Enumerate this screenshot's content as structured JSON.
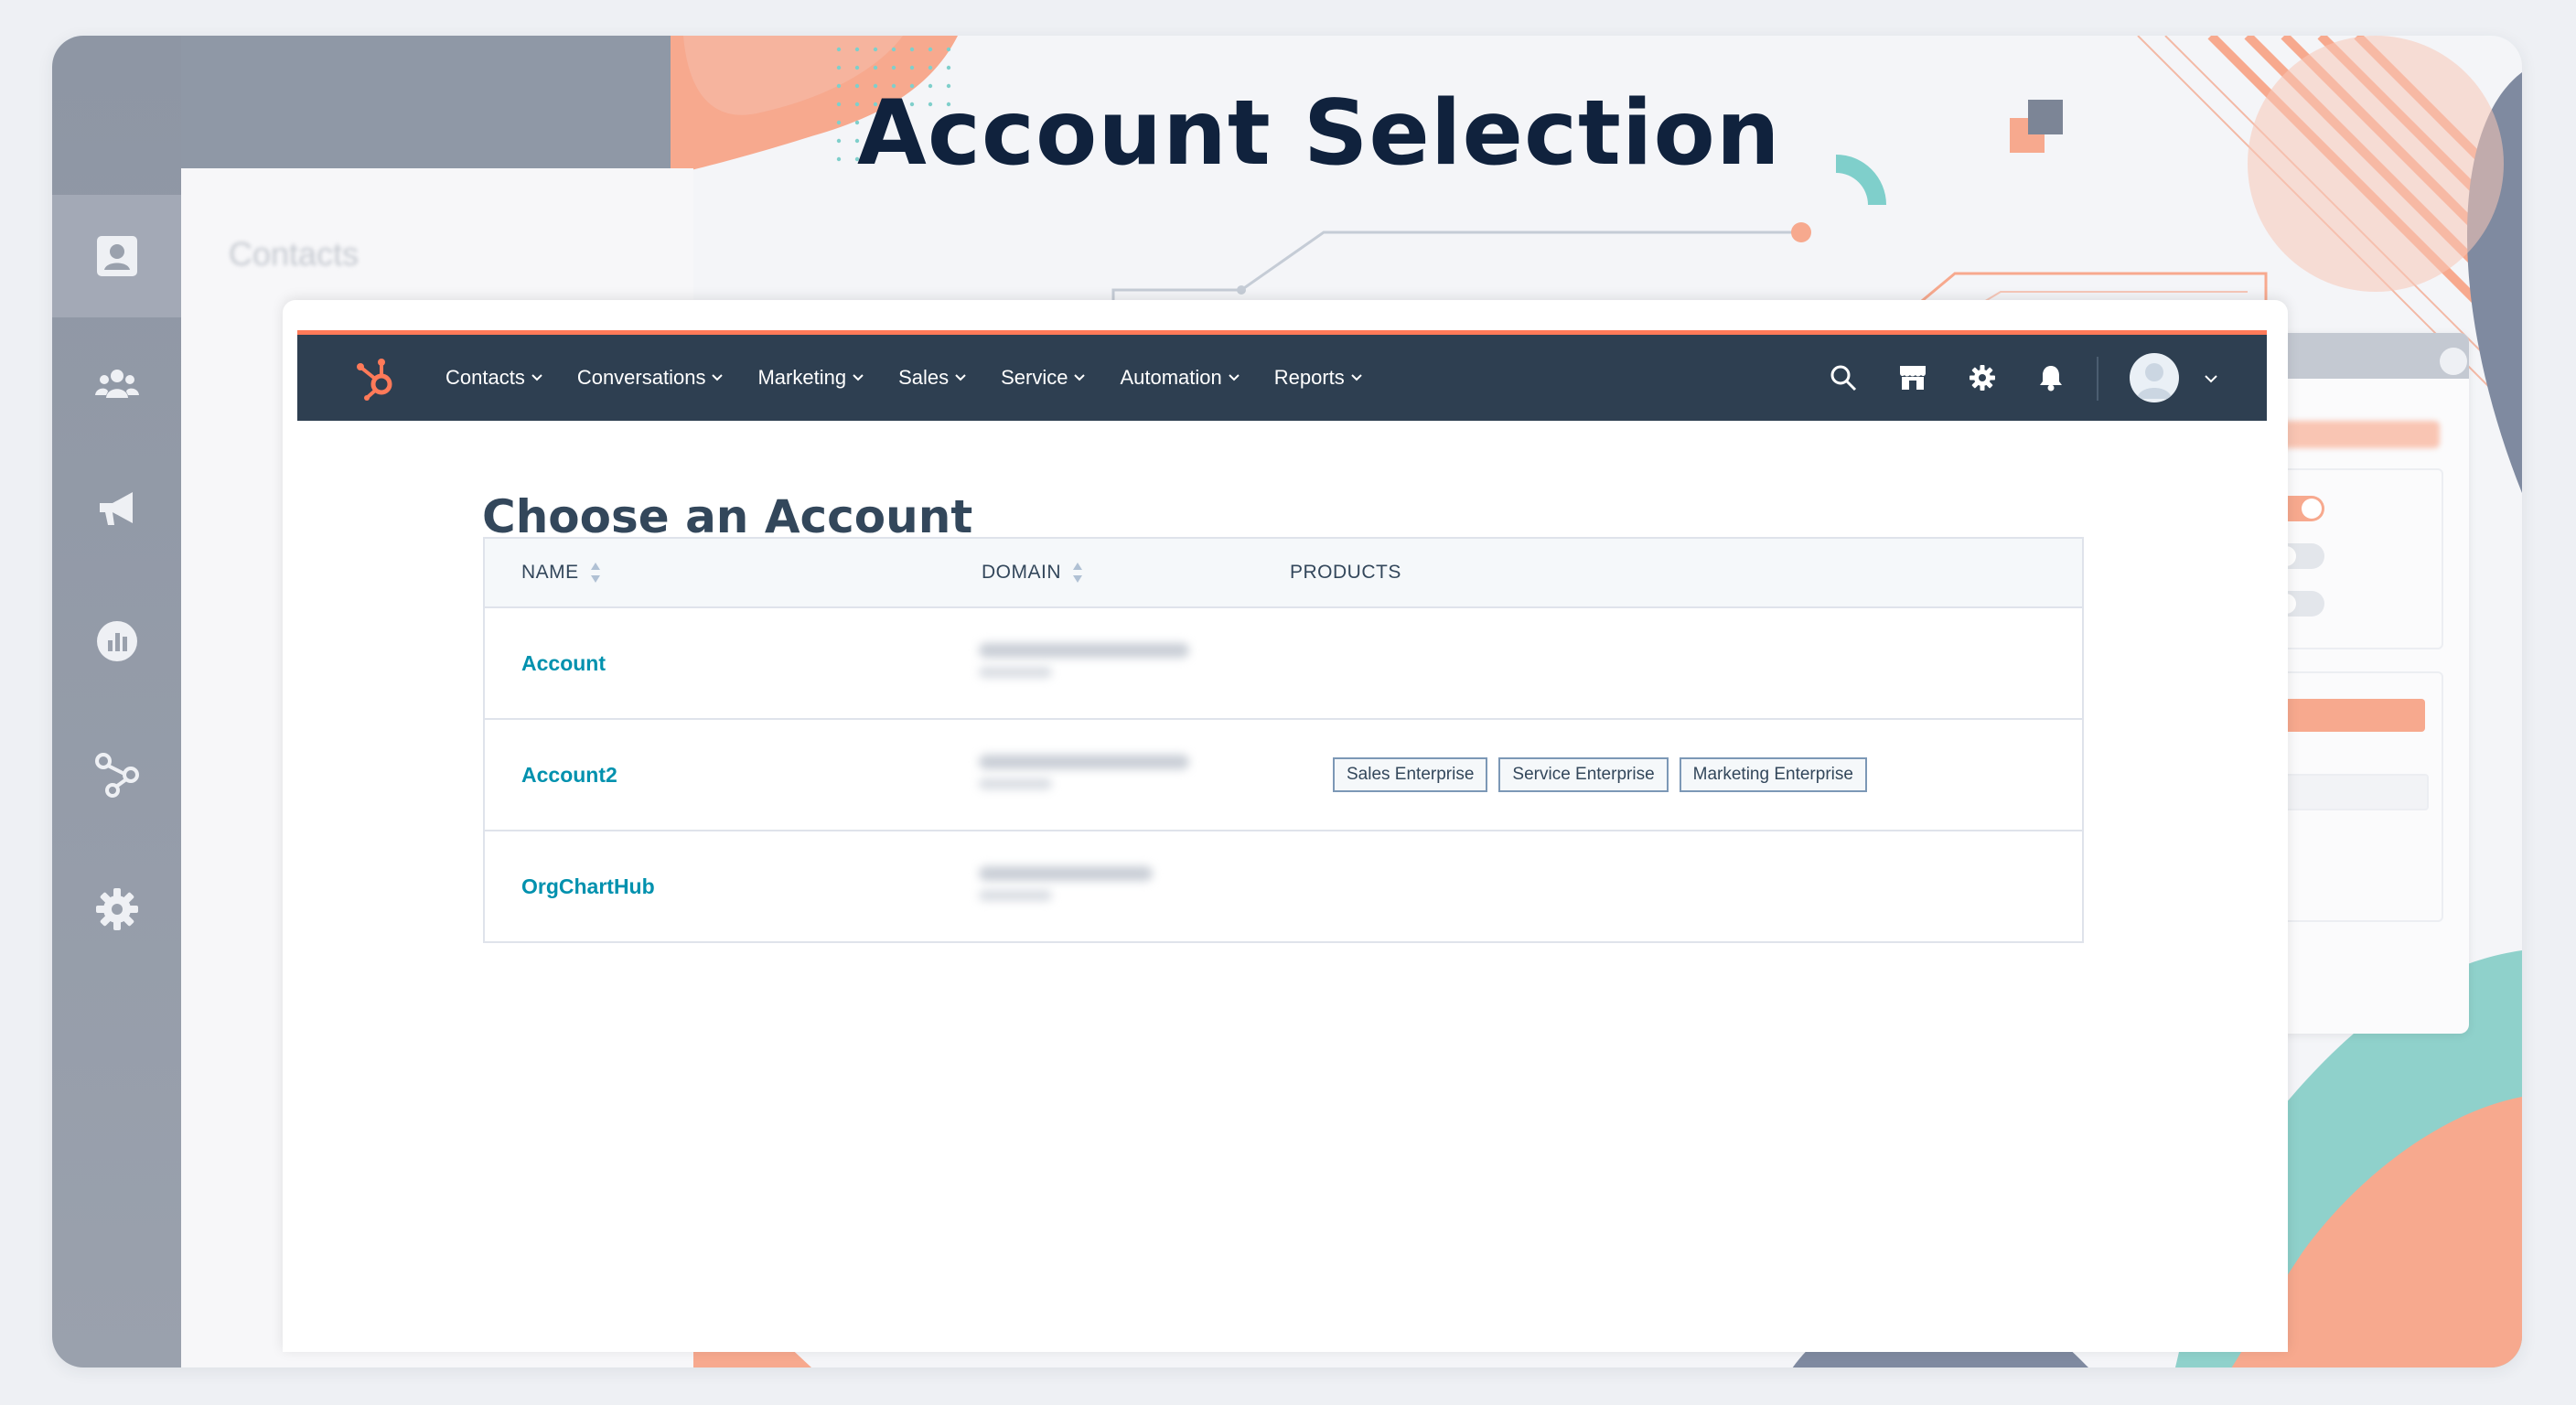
{
  "title": "Account Selection",
  "background": {
    "contacts_label": "Contacts",
    "rail_icons": [
      "contact-icon",
      "team-icon",
      "megaphone-icon",
      "reports-icon",
      "workflow-icon",
      "settings-gear-icon"
    ]
  },
  "navbar": {
    "logo": "hubspot-sprocket-icon",
    "menu": [
      {
        "label": "Contacts"
      },
      {
        "label": "Conversations"
      },
      {
        "label": "Marketing"
      },
      {
        "label": "Sales"
      },
      {
        "label": "Service"
      },
      {
        "label": "Automation"
      },
      {
        "label": "Reports"
      }
    ],
    "icons": [
      "search-icon",
      "marketplace-icon",
      "settings-icon",
      "notifications-bell-icon"
    ]
  },
  "page": {
    "heading": "Choose an Account",
    "table": {
      "columns": [
        "NAME",
        "DOMAIN",
        "PRODUCTS"
      ],
      "rows": [
        {
          "name": "Account",
          "products": []
        },
        {
          "name": "Account2",
          "products": [
            "Sales Enterprise",
            "Service Enterprise",
            "Marketing Enterprise"
          ]
        },
        {
          "name": "OrgChartHub",
          "products": []
        }
      ]
    }
  },
  "colors": {
    "title": "#10223d",
    "navbar": "#2e3f51",
    "accent_orange": "#ff7a59",
    "link": "#0091ae",
    "rail": "#9aa1ad",
    "coral": "#f7a98e",
    "teal": "#7fcfcb"
  }
}
